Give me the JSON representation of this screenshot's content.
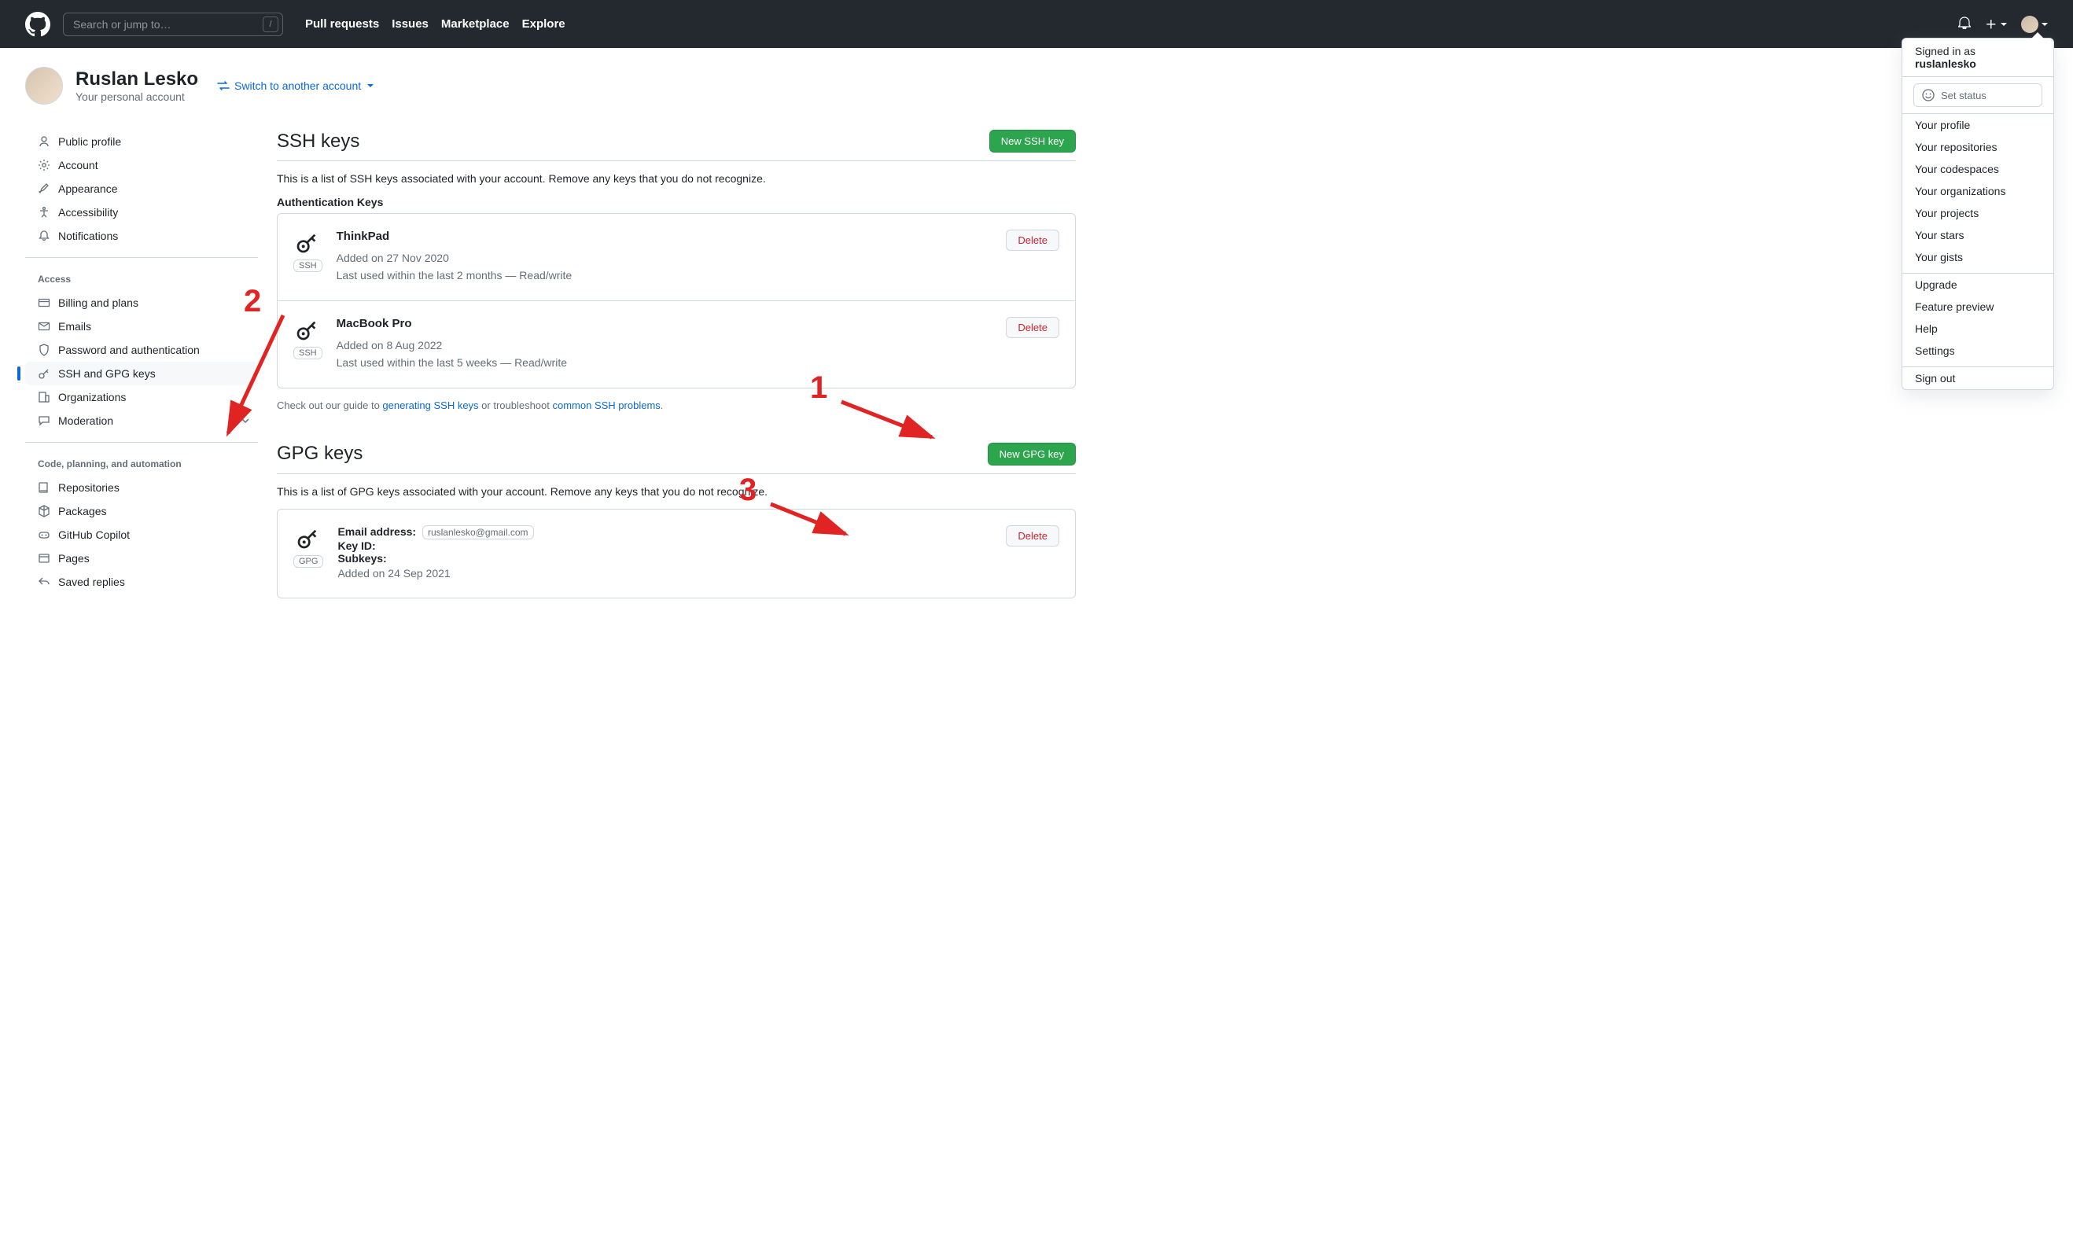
{
  "header": {
    "search_placeholder": "Search or jump to…",
    "nav": [
      "Pull requests",
      "Issues",
      "Marketplace",
      "Explore"
    ]
  },
  "user_menu": {
    "signed_in_as": "Signed in as",
    "username": "ruslanlesko",
    "set_status": "Set status",
    "items1": [
      "Your profile",
      "Your repositories",
      "Your codespaces",
      "Your organizations",
      "Your projects",
      "Your stars",
      "Your gists"
    ],
    "items2": [
      "Upgrade",
      "Feature preview",
      "Help",
      "Settings"
    ],
    "signout": "Sign out"
  },
  "profile": {
    "name": "Ruslan Lesko",
    "sub": "Your personal account",
    "switch": "Switch to another account"
  },
  "sidebar": {
    "g1": [
      "Public profile",
      "Account",
      "Appearance",
      "Accessibility",
      "Notifications"
    ],
    "access_label": "Access",
    "g2": [
      "Billing and plans",
      "Emails",
      "Password and authentication",
      "SSH and GPG keys",
      "Organizations",
      "Moderation"
    ],
    "code_label": "Code, planning, and automation",
    "g3": [
      "Repositories",
      "Packages",
      "GitHub Copilot",
      "Pages",
      "Saved replies"
    ]
  },
  "ssh": {
    "title": "SSH keys",
    "new_btn": "New SSH key",
    "desc": "This is a list of SSH keys associated with your account. Remove any keys that you do not recognize.",
    "auth_label": "Authentication Keys",
    "keys": [
      {
        "name": "ThinkPad",
        "badge": "SSH",
        "added": "Added on 27 Nov 2020",
        "used": "Last used within the last 2 months — Read/write",
        "delete": "Delete"
      },
      {
        "name": "MacBook Pro",
        "badge": "SSH",
        "added": "Added on 8 Aug 2022",
        "used": "Last used within the last 5 weeks — Read/write",
        "delete": "Delete"
      }
    ],
    "guide_pre": "Check out our guide to ",
    "guide_link1": "generating SSH keys",
    "guide_mid": " or troubleshoot ",
    "guide_link2": "common SSH problems",
    "guide_post": "."
  },
  "gpg": {
    "title": "GPG keys",
    "new_btn": "New GPG key",
    "desc": "This is a list of GPG keys associated with your account. Remove any keys that you do not recognize.",
    "badge": "GPG",
    "email_label": "Email address:",
    "email_value": "ruslanlesko@gmail.com",
    "keyid_label": "Key ID:",
    "subkeys_label": "Subkeys:",
    "added": "Added on 24 Sep 2021",
    "delete": "Delete"
  },
  "annotations": {
    "n1": "1",
    "n2": "2",
    "n3": "3"
  }
}
